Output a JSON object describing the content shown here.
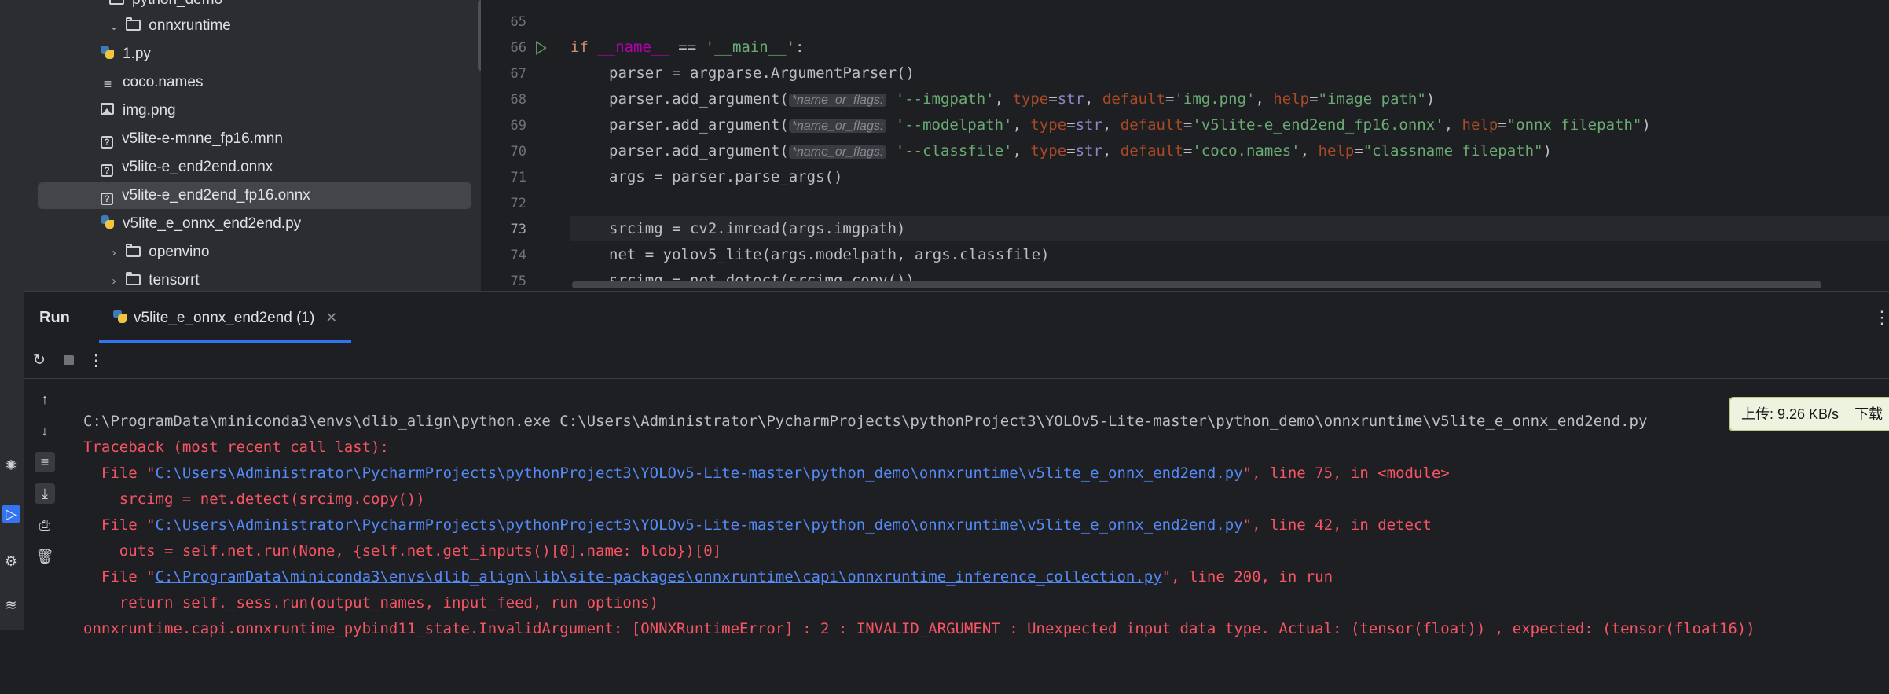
{
  "tree": {
    "items": [
      {
        "label": "python_demo",
        "kind": "folder",
        "expanded": true,
        "indent": 1
      },
      {
        "label": "onnxruntime",
        "kind": "folder",
        "expanded": true,
        "indent": 2
      },
      {
        "label": "1.py",
        "kind": "python",
        "indent": 3
      },
      {
        "label": "coco.names",
        "kind": "text",
        "indent": 3
      },
      {
        "label": "img.png",
        "kind": "image",
        "indent": 3
      },
      {
        "label": "v5lite-e-mnne_fp16.mnn",
        "kind": "unknown",
        "indent": 3
      },
      {
        "label": "v5lite-e_end2end.onnx",
        "kind": "unknown",
        "indent": 3
      },
      {
        "label": "v5lite-e_end2end_fp16.onnx",
        "kind": "unknown",
        "indent": 3,
        "selected": true
      },
      {
        "label": "v5lite_e_onnx_end2end.py",
        "kind": "python",
        "indent": 3
      },
      {
        "label": "openvino",
        "kind": "folder",
        "expanded": false,
        "indent": 2
      },
      {
        "label": "tensorrt",
        "kind": "folder",
        "expanded": false,
        "indent": 2
      }
    ]
  },
  "editor": {
    "line_numbers": [
      "65",
      "66",
      "67",
      "68",
      "69",
      "70",
      "71",
      "72",
      "73",
      "74",
      "75"
    ],
    "current_line": "73",
    "hint_label": "*name_or_flags:",
    "lines": {
      "l66": {
        "kw": "if",
        "dunder": "__name__",
        "op": " == ",
        "str": "'__main__'",
        "end": ":"
      },
      "l67": "parser = argparse.ArgumentParser()",
      "l68": {
        "pre": "parser.add_argument(",
        "flag": "'--imgpath'",
        "a1": ", ",
        "k1": "type",
        "v1": "str",
        "a2": ", ",
        "k2": "default",
        "v2": "'img.png'",
        "a3": ", ",
        "k3": "help",
        "v3": "\"image path\"",
        "end": ")"
      },
      "l69": {
        "pre": "parser.add_argument(",
        "flag": "'--modelpath'",
        "a1": ", ",
        "k1": "type",
        "v1": "str",
        "a2": ", ",
        "k2": "default",
        "v2": "'v5lite-e_end2end_fp16.onnx'",
        "a3": ", ",
        "k3": "help",
        "v3": "\"onnx filepath\"",
        "end": ")"
      },
      "l70": {
        "pre": "parser.add_argument(",
        "flag": "'--classfile'",
        "a1": ", ",
        "k1": "type",
        "v1": "str",
        "a2": ", ",
        "k2": "default",
        "v2": "'coco.names'",
        "a3": ", ",
        "k3": "help",
        "v3": "\"classname filepath\"",
        "end": ")"
      },
      "l71": "args = parser.parse_args()",
      "l73": "srcimg = cv2.imread(args.imgpath)",
      "l74": "net = yolov5_lite(args.modelpath, args.classfile)",
      "l75": "srcimg = net.detect(srcimg.copy())"
    }
  },
  "run": {
    "title": "Run",
    "tab_label": "v5lite_e_onnx_end2end (1)",
    "console": {
      "cmd": "C:\\ProgramData\\miniconda3\\envs\\dlib_align\\python.exe C:\\Users\\Administrator\\PycharmProjects\\pythonProject3\\YOLOv5-Lite-master\\python_demo\\onnxruntime\\v5lite_e_onnx_end2end.py",
      "traceback": "Traceback (most recent call last):",
      "f1_pre": "  File \"",
      "f1_link": "C:\\Users\\Administrator\\PycharmProjects\\pythonProject3\\YOLOv5-Lite-master\\python_demo\\onnxruntime\\v5lite_e_onnx_end2end.py",
      "f1_post": "\", line 75, in <module>",
      "f1_code": "    srcimg = net.detect(srcimg.copy())",
      "f2_pre": "  File \"",
      "f2_link": "C:\\Users\\Administrator\\PycharmProjects\\pythonProject3\\YOLOv5-Lite-master\\python_demo\\onnxruntime\\v5lite_e_onnx_end2end.py",
      "f2_post": "\", line 42, in detect",
      "f2_code": "    outs = self.net.run(None, {self.net.get_inputs()[0].name: blob})[0]",
      "f3_pre": "  File \"",
      "f3_link": "C:\\ProgramData\\miniconda3\\envs\\dlib_align\\lib\\site-packages\\onnxruntime\\capi\\onnxruntime_inference_collection.py",
      "f3_post": "\", line 200, in run",
      "f3_code": "    return self._sess.run(output_names, input_feed, run_options)",
      "error": "onnxruntime.capi.onnxruntime_pybind11_state.InvalidArgument: [ONNXRuntimeError] : 2 : INVALID_ARGUMENT : Unexpected input data type. Actual: (tensor(float)) , expected: (tensor(float16))"
    }
  },
  "net_badge": {
    "upload": "上传: 9.26 KB/s",
    "download": "下载"
  },
  "colors": {
    "accent": "#3574f0",
    "error": "#f75464",
    "link": "#548af7",
    "string": "#6aab73",
    "keyword": "#cf8e6d"
  }
}
